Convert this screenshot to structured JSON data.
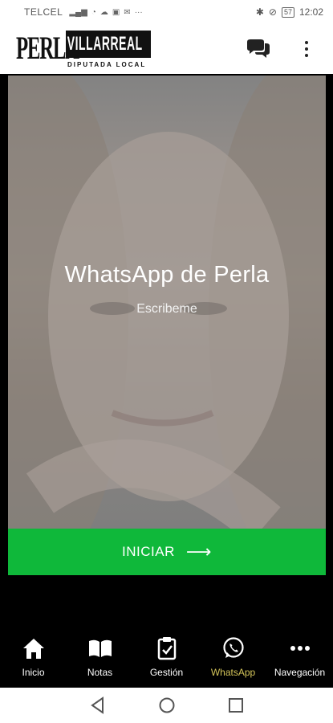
{
  "status_bar": {
    "carrier": "TELCEL",
    "battery": "57",
    "time": "12:02"
  },
  "app_bar": {
    "logo_word_1": "PERLA",
    "logo_word_2": "VILLARREAL",
    "logo_tagline": "DIPUTADA LOCAL",
    "actions": [
      "chat-icon",
      "more-vert-icon"
    ]
  },
  "hero": {
    "title": "WhatsApp de Perla",
    "subtitle": "Escribeme",
    "button_label": "INICIAR",
    "button_color": "#0fb83a"
  },
  "bottom_nav": {
    "items": [
      {
        "label": "Inicio",
        "icon": "home-icon"
      },
      {
        "label": "Notas",
        "icon": "book-icon"
      },
      {
        "label": "Gestión",
        "icon": "clipboard-icon"
      },
      {
        "label": "WhatsApp",
        "icon": "whatsapp-icon",
        "active": true
      },
      {
        "label": "Navegación",
        "icon": "more-horiz-icon"
      }
    ],
    "active_color": "#d4c55a"
  }
}
